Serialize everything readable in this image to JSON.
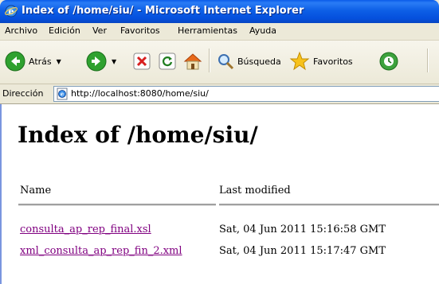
{
  "window": {
    "title": "Index of /home/siu/ - Microsoft Internet Explorer",
    "icon": "ie-icon"
  },
  "menu": [
    "Archivo",
    "Edición",
    "Ver",
    "Favoritos",
    "Herramientas",
    "Ayuda"
  ],
  "toolbar": {
    "back_label": "Atrás",
    "search_label": "Búsqueda",
    "favorites_label": "Favoritos"
  },
  "address": {
    "label": "Dirección",
    "url": "http://localhost:8080/home/siu/"
  },
  "page": {
    "title": "Index of /home/siu/",
    "columns": [
      "Name",
      "Last modified"
    ],
    "files": [
      {
        "name": "consulta_ap_rep_final.xsl",
        "modified": "Sat, 04 Jun 2011 15:16:58 GMT"
      },
      {
        "name": "xml_consulta_ap_rep_fin_2.xml",
        "modified": "Sat, 04 Jun 2011 15:17:47 GMT"
      }
    ]
  },
  "colors": {
    "titlebar": "#0a5be8",
    "visited_link": "#800080"
  }
}
